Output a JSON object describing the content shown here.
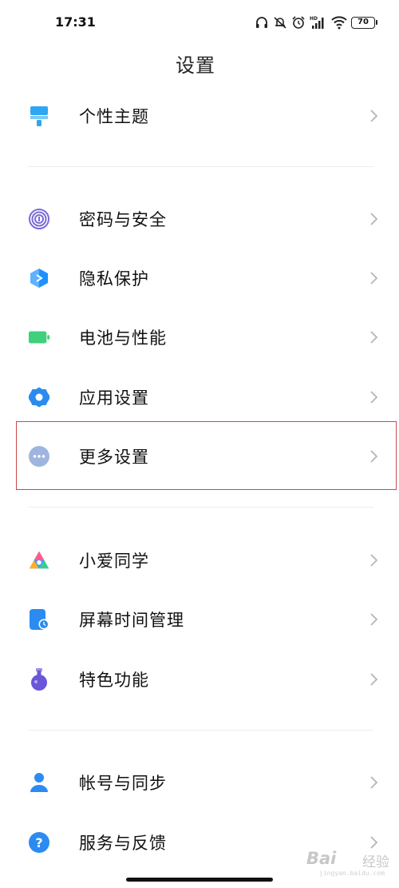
{
  "status_bar": {
    "time": "17:31",
    "battery": "70",
    "icons": [
      "headphones-icon",
      "mute-bell-icon",
      "alarm-icon",
      "hd-signal-icon",
      "wifi-icon",
      "battery-icon"
    ]
  },
  "page": {
    "title": "设置"
  },
  "settings": [
    {
      "label": "个性主题",
      "icon": "theme-brush-icon",
      "color": "#2fa6f2"
    },
    {
      "label": "密码与安全",
      "icon": "fingerprint-icon",
      "color": "#7a6bd8"
    },
    {
      "label": "隐私保护",
      "icon": "privacy-shield-icon",
      "color": "#1e90ff"
    },
    {
      "label": "电池与性能",
      "icon": "battery-performance-icon",
      "color": "#3fd07b"
    },
    {
      "label": "应用设置",
      "icon": "app-gear-icon",
      "color": "#2b8bf0"
    },
    {
      "label": "更多设置",
      "icon": "more-dots-icon",
      "color": "#9fb4de"
    },
    {
      "label": "小爱同学",
      "icon": "xiaoai-icon",
      "color": "#3aa0ff"
    },
    {
      "label": "屏幕时间管理",
      "icon": "screen-time-icon",
      "color": "#2b8bf0"
    },
    {
      "label": "特色功能",
      "icon": "feature-flask-icon",
      "color": "#6a56d8"
    },
    {
      "label": "帐号与同步",
      "icon": "account-person-icon",
      "color": "#2b8bf0"
    },
    {
      "label": "服务与反馈",
      "icon": "help-question-icon",
      "color": "#2b8bf0"
    }
  ],
  "highlighted_item": "更多设置",
  "watermark": {
    "logo": "Bai",
    "text": "经验",
    "url": "jingyan.baidu.com"
  }
}
